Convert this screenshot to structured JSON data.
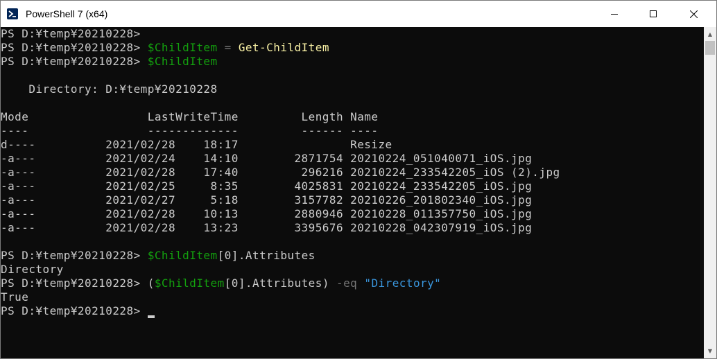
{
  "window": {
    "title": "PowerShell 7 (x64)",
    "icon": "powershell-icon",
    "controls": {
      "minimize": "─",
      "maximize": "☐",
      "close": "✕"
    }
  },
  "colors": {
    "background": "#0c0c0c",
    "foreground": "#cccccc",
    "variable": "#13a10e",
    "command": "#f9f1a5",
    "operator": "#767676",
    "string": "#3a96dd"
  },
  "console": {
    "prompt": "PS D:¥temp¥20210228>",
    "l1": {
      "prompt": "PS D:¥temp¥20210228>"
    },
    "l2": {
      "prompt": "PS D:¥temp¥20210228>",
      "var": "$ChildItem",
      "op": " = ",
      "cmd": "Get-ChildItem"
    },
    "l3": {
      "prompt": "PS D:¥temp¥20210228>",
      "var": "$ChildItem"
    },
    "directory_line": "    Directory: D:¥temp¥20210228",
    "header": "Mode                 LastWriteTime         Length Name",
    "underline": "----                 -------------         ------ ----",
    "rows": [
      "d----          2021/02/28    18:17                Resize",
      "-a---          2021/02/24    14:10        2871754 20210224_051040071_iOS.jpg",
      "-a---          2021/02/28    17:40         296216 20210224_233542205_iOS (2).jpg",
      "-a---          2021/02/25     8:35        4025831 20210224_233542205_iOS.jpg",
      "-a---          2021/02/27     5:18        3157782 20210226_201802340_iOS.jpg",
      "-a---          2021/02/28    10:13        2880946 20210228_011357750_iOS.jpg",
      "-a---          2021/02/28    13:23        3395676 20210228_042307919_iOS.jpg"
    ],
    "l4": {
      "prompt": "PS D:¥temp¥20210228>",
      "var": "$ChildItem",
      "rest": "[0].Attributes"
    },
    "out1": "Directory",
    "l5": {
      "prompt": "PS D:¥temp¥20210228>",
      "paren_open": "(",
      "var": "$ChildItem",
      "rest": "[0].Attributes)",
      "op": "-eq",
      "str": "\"Directory\""
    },
    "out2": "True",
    "l6": {
      "prompt": "PS D:¥temp¥20210228>"
    }
  },
  "scrollbar": {
    "up": "▲",
    "down": "▼"
  }
}
